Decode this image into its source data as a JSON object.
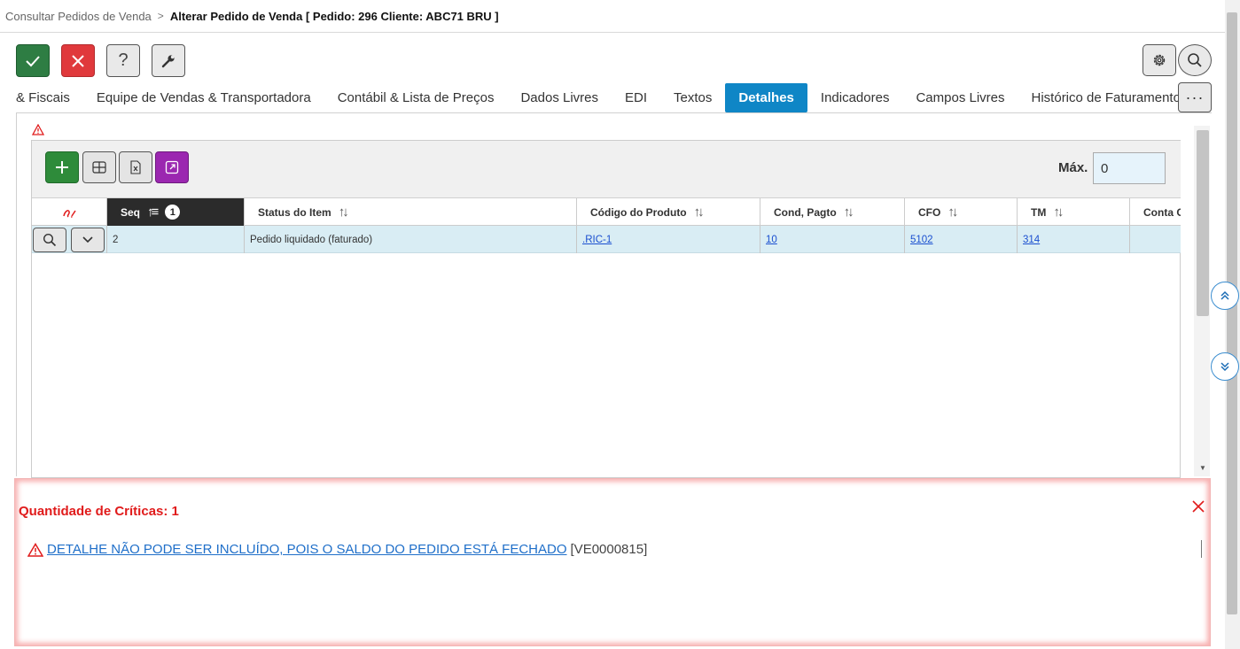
{
  "breadcrumb": {
    "parent": "Consultar Pedidos de Venda",
    "separator": ">",
    "current": "Alterar Pedido de Venda [ Pedido: 296 Cliente: ABC71 BRU ]"
  },
  "toolbar": {
    "help_label": "?"
  },
  "tabs": [
    {
      "label": "& Fiscais",
      "active": false
    },
    {
      "label": "Equipe de Vendas & Transportadora",
      "active": false
    },
    {
      "label": "Contábil & Lista de Preços",
      "active": false
    },
    {
      "label": "Dados Livres",
      "active": false
    },
    {
      "label": "EDI",
      "active": false
    },
    {
      "label": "Textos",
      "active": false
    },
    {
      "label": "Detalhes",
      "active": true
    },
    {
      "label": "Indicadores",
      "active": false
    },
    {
      "label": "Campos Livres",
      "active": false
    },
    {
      "label": "Histórico de Faturamento",
      "active": false
    }
  ],
  "more_label": "···",
  "grid": {
    "max_label": "Máx.",
    "max_value": "0",
    "sort_badge": "1",
    "columns": [
      "Seq",
      "Status do Item",
      "Código do Produto",
      "Cond, Pagto",
      "CFO",
      "TM",
      "Conta C"
    ],
    "rows": [
      {
        "seq": "2",
        "status": "Pedido liquidado (faturado)",
        "produto": ".RIC-1",
        "cond": "10",
        "cfo": "5102",
        "tm": "314",
        "conta": ""
      }
    ]
  },
  "errors": {
    "title": "Quantidade de Críticas: 1",
    "items": [
      {
        "message": "DETALHE NÃO PODE SER INCLUÍDO, POIS O SALDO DO PEDIDO ESTÁ FECHADO",
        "code": "[VE0000815]"
      }
    ]
  },
  "colors": {
    "active_tab": "#0f86c6",
    "confirm": "#2e7d43",
    "cancel": "#e0393c",
    "error_text": "#e01b1b",
    "row_highlight": "#d9edf4"
  }
}
